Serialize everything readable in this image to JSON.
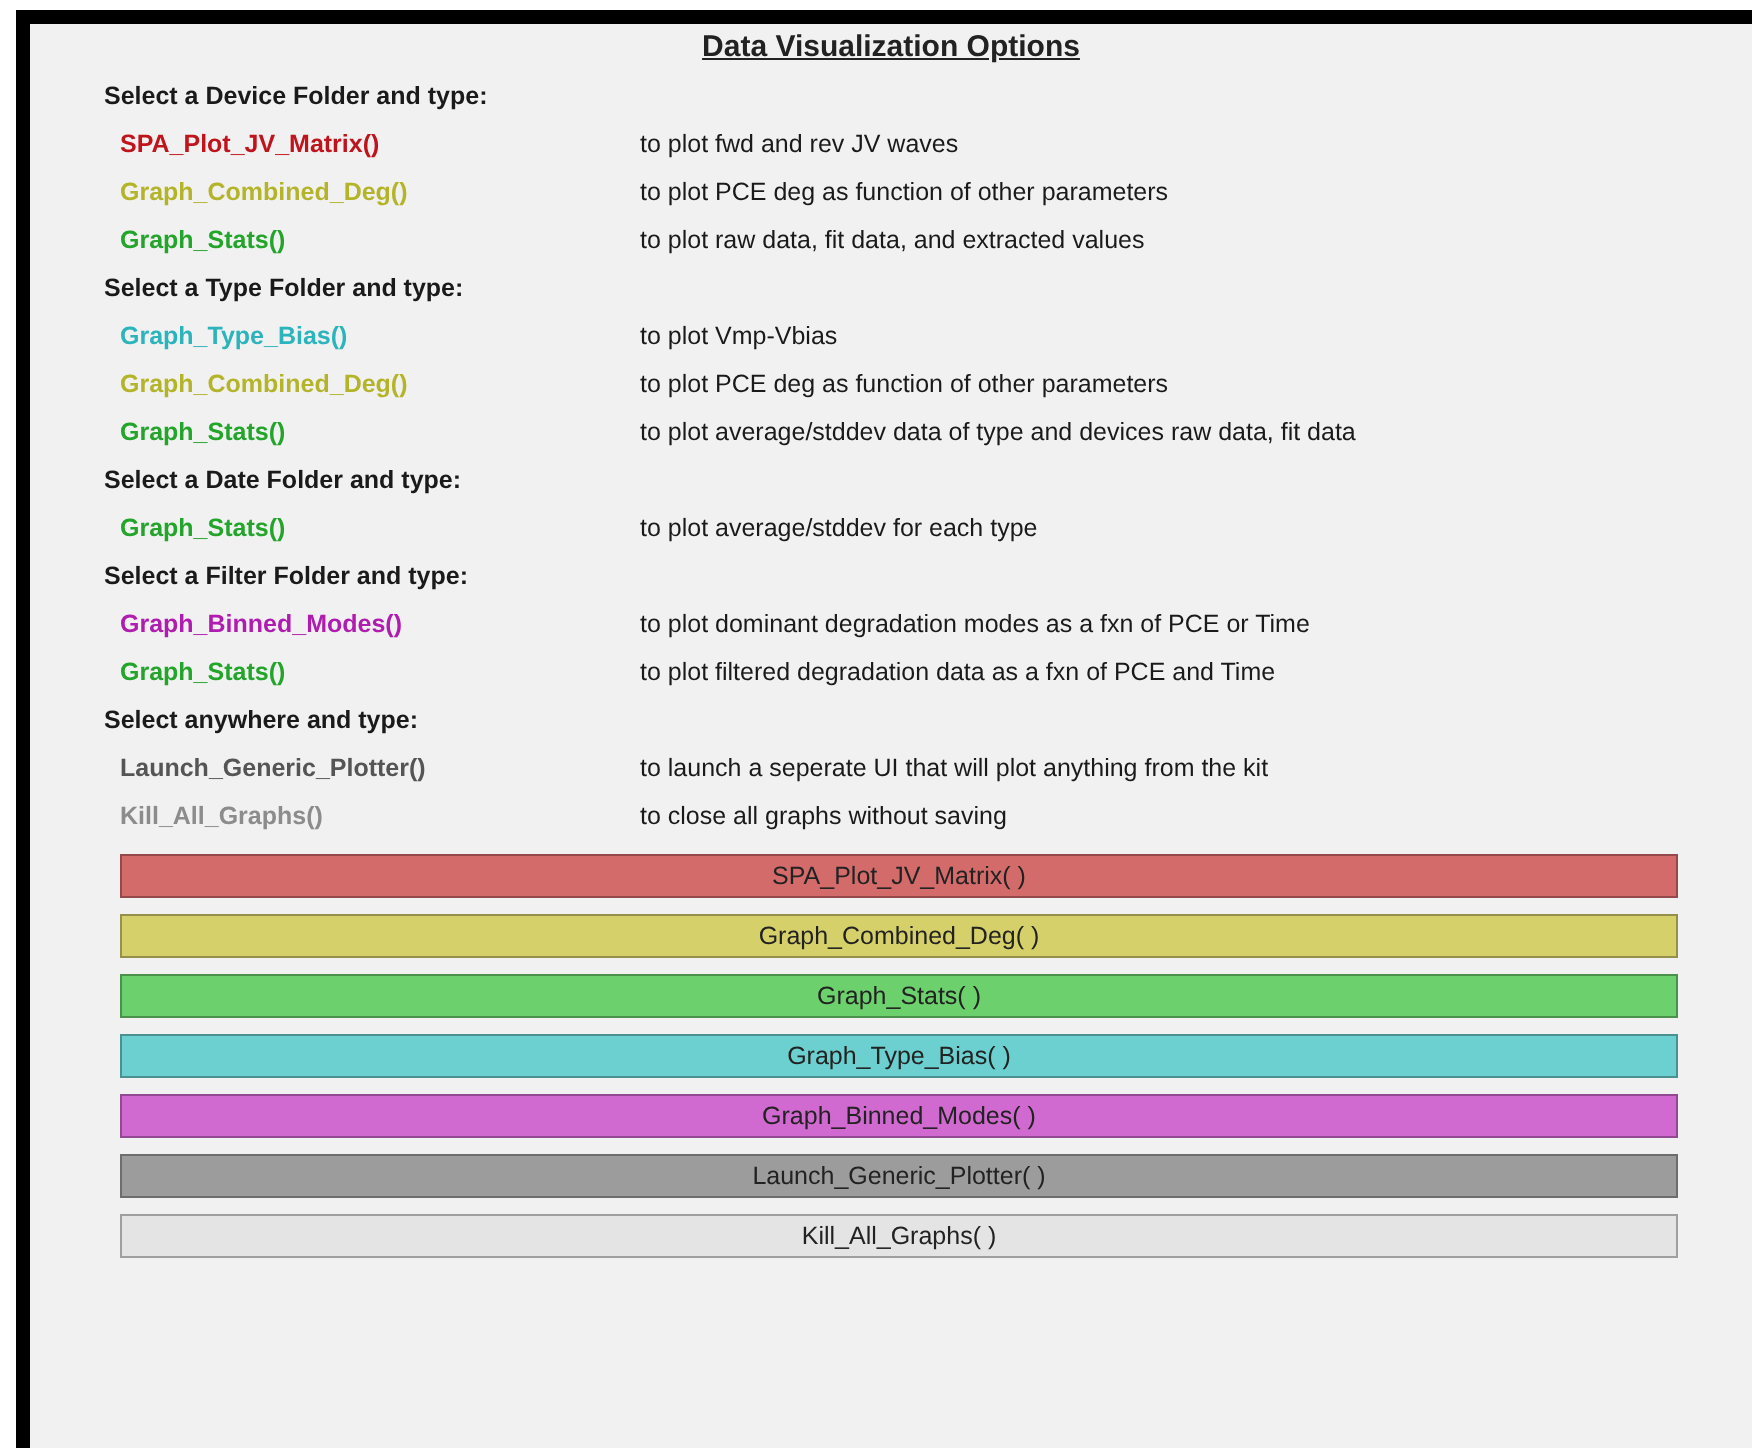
{
  "title": "Data Visualization Options",
  "sections": [
    {
      "heading": "Select a Device Folder and type:",
      "items": [
        {
          "function": "SPA_Plot_JV_Matrix()",
          "color": "#c0141c",
          "description": "to plot fwd and rev JV waves"
        },
        {
          "function": "Graph_Combined_Deg()",
          "color": "#b4b42a",
          "description": "to plot PCE deg as function of other parameters"
        },
        {
          "function": "Graph_Stats()",
          "color": "#22a52a",
          "description": "to plot raw data, fit data, and extracted values"
        }
      ]
    },
    {
      "heading": "Select a Type Folder and type:",
      "items": [
        {
          "function": "Graph_Type_Bias()",
          "color": "#2cb4bc",
          "description": "to plot Vmp-Vbias"
        },
        {
          "function": "Graph_Combined_Deg()",
          "color": "#b4b42a",
          "description": "to plot PCE deg as function of other parameters"
        },
        {
          "function": "Graph_Stats()",
          "color": "#22a52a",
          "description": "to plot average/stddev data of type and devices raw data, fit data"
        }
      ]
    },
    {
      "heading": "Select a Date Folder and type:",
      "items": [
        {
          "function": "Graph_Stats()",
          "color": "#22a52a",
          "description": "to plot average/stddev for each type"
        }
      ]
    },
    {
      "heading": "Select a Filter Folder and type:",
      "items": [
        {
          "function": "Graph_Binned_Modes()",
          "color": "#b01cb0",
          "description": "to plot dominant degradation modes as a fxn of PCE or Time"
        },
        {
          "function": "Graph_Stats()",
          "color": "#22a52a",
          "description": "to plot filtered degradation data as a fxn of PCE and Time"
        }
      ]
    },
    {
      "heading": "Select anywhere and type:",
      "items": [
        {
          "function": "Launch_Generic_Plotter()",
          "color": "#555555",
          "description": "to launch a seperate UI that will plot anything from the kit"
        },
        {
          "function": "Kill_All_Graphs()",
          "color": "#8c8c8c",
          "description": "to close all graphs without saving"
        }
      ]
    }
  ],
  "buttons": [
    {
      "label": "SPA_Plot_JV_Matrix( )",
      "color": "#d46b6b"
    },
    {
      "label": "Graph_Combined_Deg( )",
      "color": "#d6d06b"
    },
    {
      "label": "Graph_Stats( )",
      "color": "#6cd06c"
    },
    {
      "label": "Graph_Type_Bias( )",
      "color": "#6cd0d0"
    },
    {
      "label": "Graph_Binned_Modes( )",
      "color": "#d06ad0"
    },
    {
      "label": "Launch_Generic_Plotter( )",
      "color": "#9c9c9c"
    },
    {
      "label": "Kill_All_Graphs( )",
      "color": "#e4e4e4"
    }
  ]
}
